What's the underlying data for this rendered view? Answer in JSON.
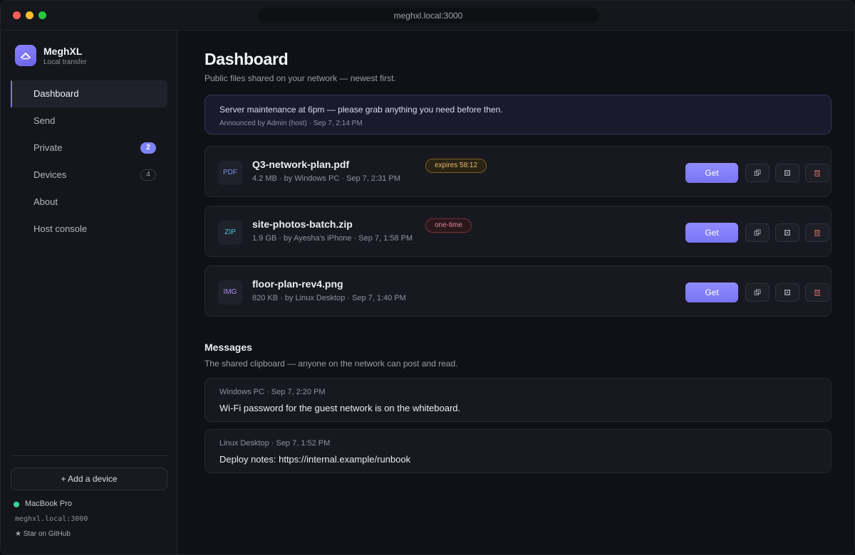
{
  "window": {
    "url": "meghxl.local:3000"
  },
  "sidebar": {
    "brand_name": "MeghXL",
    "brand_sub": "Local transfer",
    "items": [
      {
        "label": "Dashboard"
      },
      {
        "label": "Send"
      },
      {
        "label": "Private",
        "badge": "2"
      },
      {
        "label": "Devices",
        "badge": "4"
      },
      {
        "label": "About"
      },
      {
        "label": "Host console"
      }
    ],
    "add_device": "+ Add a device",
    "host_name": "MacBook Pro",
    "host_address": "meghxl.local:3000",
    "github": "★ Star on GitHub"
  },
  "main": {
    "title": "Dashboard",
    "subtitle": "Public files shared on your network — newest first.",
    "announcement": {
      "text": "Server maintenance at 6pm — please grab anything you need before then.",
      "meta": "Announced by Admin (host) · Sep 7, 2:14 PM"
    },
    "files": [
      {
        "type": "PDF",
        "type_color": "#7e8cf0",
        "name": "Q3-network-plan.pdf",
        "meta": "4.2 MB · by Windows PC · Sep 7, 2:31 PM",
        "tag": "expires 58:12",
        "get": "Get"
      },
      {
        "type": "ZIP",
        "type_color": "#4fc3e8",
        "name": "site-photos-batch.zip",
        "meta": "1.9 GB · by Ayesha's iPhone · Sep 7, 1:58 PM",
        "tag": "one-time",
        "get": "Get"
      },
      {
        "type": "IMG",
        "type_color": "#a98af5",
        "name": "floor-plan-rev4.png",
        "meta": "820 KB · by Linux Desktop · Sep 7, 1:40 PM",
        "tag": "",
        "get": "Get"
      }
    ],
    "messages_title": "Messages",
    "messages_subtitle": "The shared clipboard — anyone on the network can post and read.",
    "messages": [
      {
        "meta": "Windows PC · Sep 7, 2:20 PM",
        "body": "Wi-Fi password for the guest network is on the whiteboard."
      },
      {
        "meta": "Linux Desktop · Sep 7, 1:52 PM",
        "body": "Deploy notes: https://internal.example/runbook"
      }
    ]
  },
  "colors": {
    "accent": "#7c74ff",
    "online": "#34d399",
    "expires": "#e8b86a",
    "one_time": "#e38a98"
  }
}
